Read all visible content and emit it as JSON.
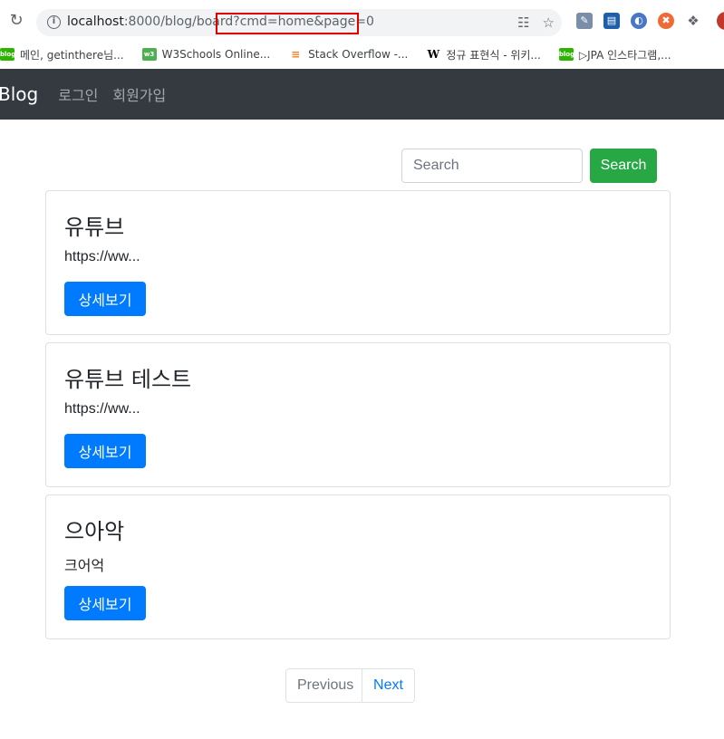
{
  "browser": {
    "url_host": "localhost",
    "url_path": ":8000/blog/board?cmd=home&page=0",
    "bookmarks": [
      {
        "label": "메인, getinthere님...",
        "icon": "blog",
        "color": "#2db400"
      },
      {
        "label": "W3Schools Online...",
        "icon": "w3",
        "color": "#4caf50"
      },
      {
        "label": "Stack Overflow -...",
        "icon": "so",
        "color": "#f48024"
      },
      {
        "label": "정규 표현식 - 위키...",
        "icon": "W",
        "color": "#000000"
      },
      {
        "label": "▷JPA 인스타그램,...",
        "icon": "blog",
        "color": "#2db400"
      }
    ]
  },
  "navbar": {
    "brand": "Blog",
    "links": [
      "로그인",
      "회원가입"
    ]
  },
  "search": {
    "placeholder": "Search",
    "button": "Search"
  },
  "cards": [
    {
      "title": "유튜브",
      "text": "https://ww...",
      "button": "상세보기"
    },
    {
      "title": "유튜브 테스트",
      "text": "https://ww...",
      "button": "상세보기"
    },
    {
      "title": "으아악",
      "text": "크어억",
      "button": "상세보기"
    }
  ],
  "pagination": {
    "previous": "Previous",
    "next": "Next"
  },
  "colors": {
    "navbar": "#343a40",
    "primary": "#007bff",
    "success": "#28a745",
    "highlight": "#e00000"
  }
}
